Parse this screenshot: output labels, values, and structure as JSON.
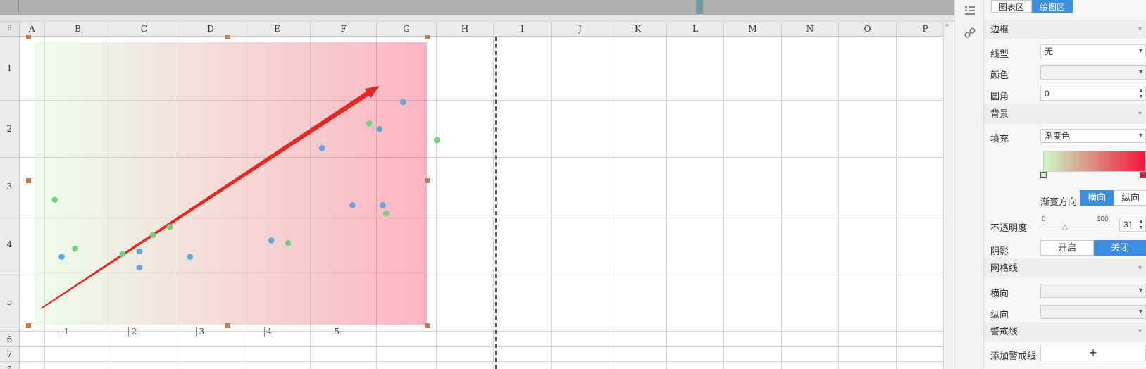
{
  "sheet": {
    "columns": [
      "A",
      "B",
      "C",
      "D",
      "E",
      "F",
      "G",
      "H",
      "I",
      "J",
      "K",
      "L",
      "M",
      "N",
      "O",
      "P"
    ],
    "rows": [
      "1",
      "2",
      "3",
      "4",
      "5",
      "6",
      "7",
      "8"
    ]
  },
  "chart_data": {
    "type": "scatter",
    "x_ticks": [
      "1",
      "2",
      "3",
      "4",
      "5"
    ],
    "xlim": [
      0.6,
      6.4
    ],
    "ylim": [
      0,
      5.2
    ],
    "background": {
      "gradient_from": "#CAFAC4",
      "gradient_to": "#F53C5A",
      "direction": "horizontal"
    },
    "arrow": {
      "from": [
        0.7,
        0.3
      ],
      "to": [
        5.7,
        4.4
      ],
      "color": "#E8281E"
    },
    "series": [
      {
        "color": "#5AA9E6",
        "points": [
          [
            1.0,
            1.25
          ],
          [
            2.15,
            1.35
          ],
          [
            2.15,
            1.05
          ],
          [
            2.9,
            1.25
          ],
          [
            4.1,
            1.55
          ],
          [
            4.85,
            3.25
          ],
          [
            5.3,
            2.2
          ],
          [
            5.7,
            3.6
          ],
          [
            5.75,
            2.2
          ],
          [
            6.05,
            4.1
          ]
        ]
      },
      {
        "color": "#6FD47A",
        "points": [
          [
            0.9,
            2.3
          ],
          [
            1.2,
            1.4
          ],
          [
            1.9,
            1.3
          ],
          [
            2.35,
            1.65
          ],
          [
            2.6,
            1.8
          ],
          [
            4.35,
            1.5
          ],
          [
            5.55,
            3.7
          ],
          [
            5.8,
            2.05
          ],
          [
            6.55,
            3.4
          ]
        ]
      }
    ]
  },
  "toolbar": {
    "link_icon": "link-icon",
    "list_icon": "list-icon"
  },
  "panel": {
    "tab_chart": "图表区",
    "tab_plot": "绘图区",
    "border": {
      "title": "边框",
      "line_type_label": "线型",
      "line_type_value": "无",
      "color_label": "颜色",
      "radius_label": "圆角",
      "radius_value": "0"
    },
    "background": {
      "title": "背景",
      "fill_label": "填充",
      "fill_value": "渐变色",
      "gradient_start_color": "#CAFAC4",
      "gradient_end_color": "#F5133C",
      "direction_label": "渐变方向",
      "dir_horizontal": "横向",
      "dir_vertical": "纵向",
      "opacity_label": "不透明度",
      "opacity_min": "0",
      "opacity_max": "100",
      "opacity_value": "31",
      "shadow_label": "阴影",
      "shadow_on": "开启",
      "shadow_off": "关闭"
    },
    "gridlines": {
      "title": "网格线",
      "horizontal_label": "横向",
      "vertical_label": "纵向"
    },
    "alert_lines": {
      "title": "警戒线",
      "add_label": "添加警戒线",
      "add_button": "+"
    }
  }
}
